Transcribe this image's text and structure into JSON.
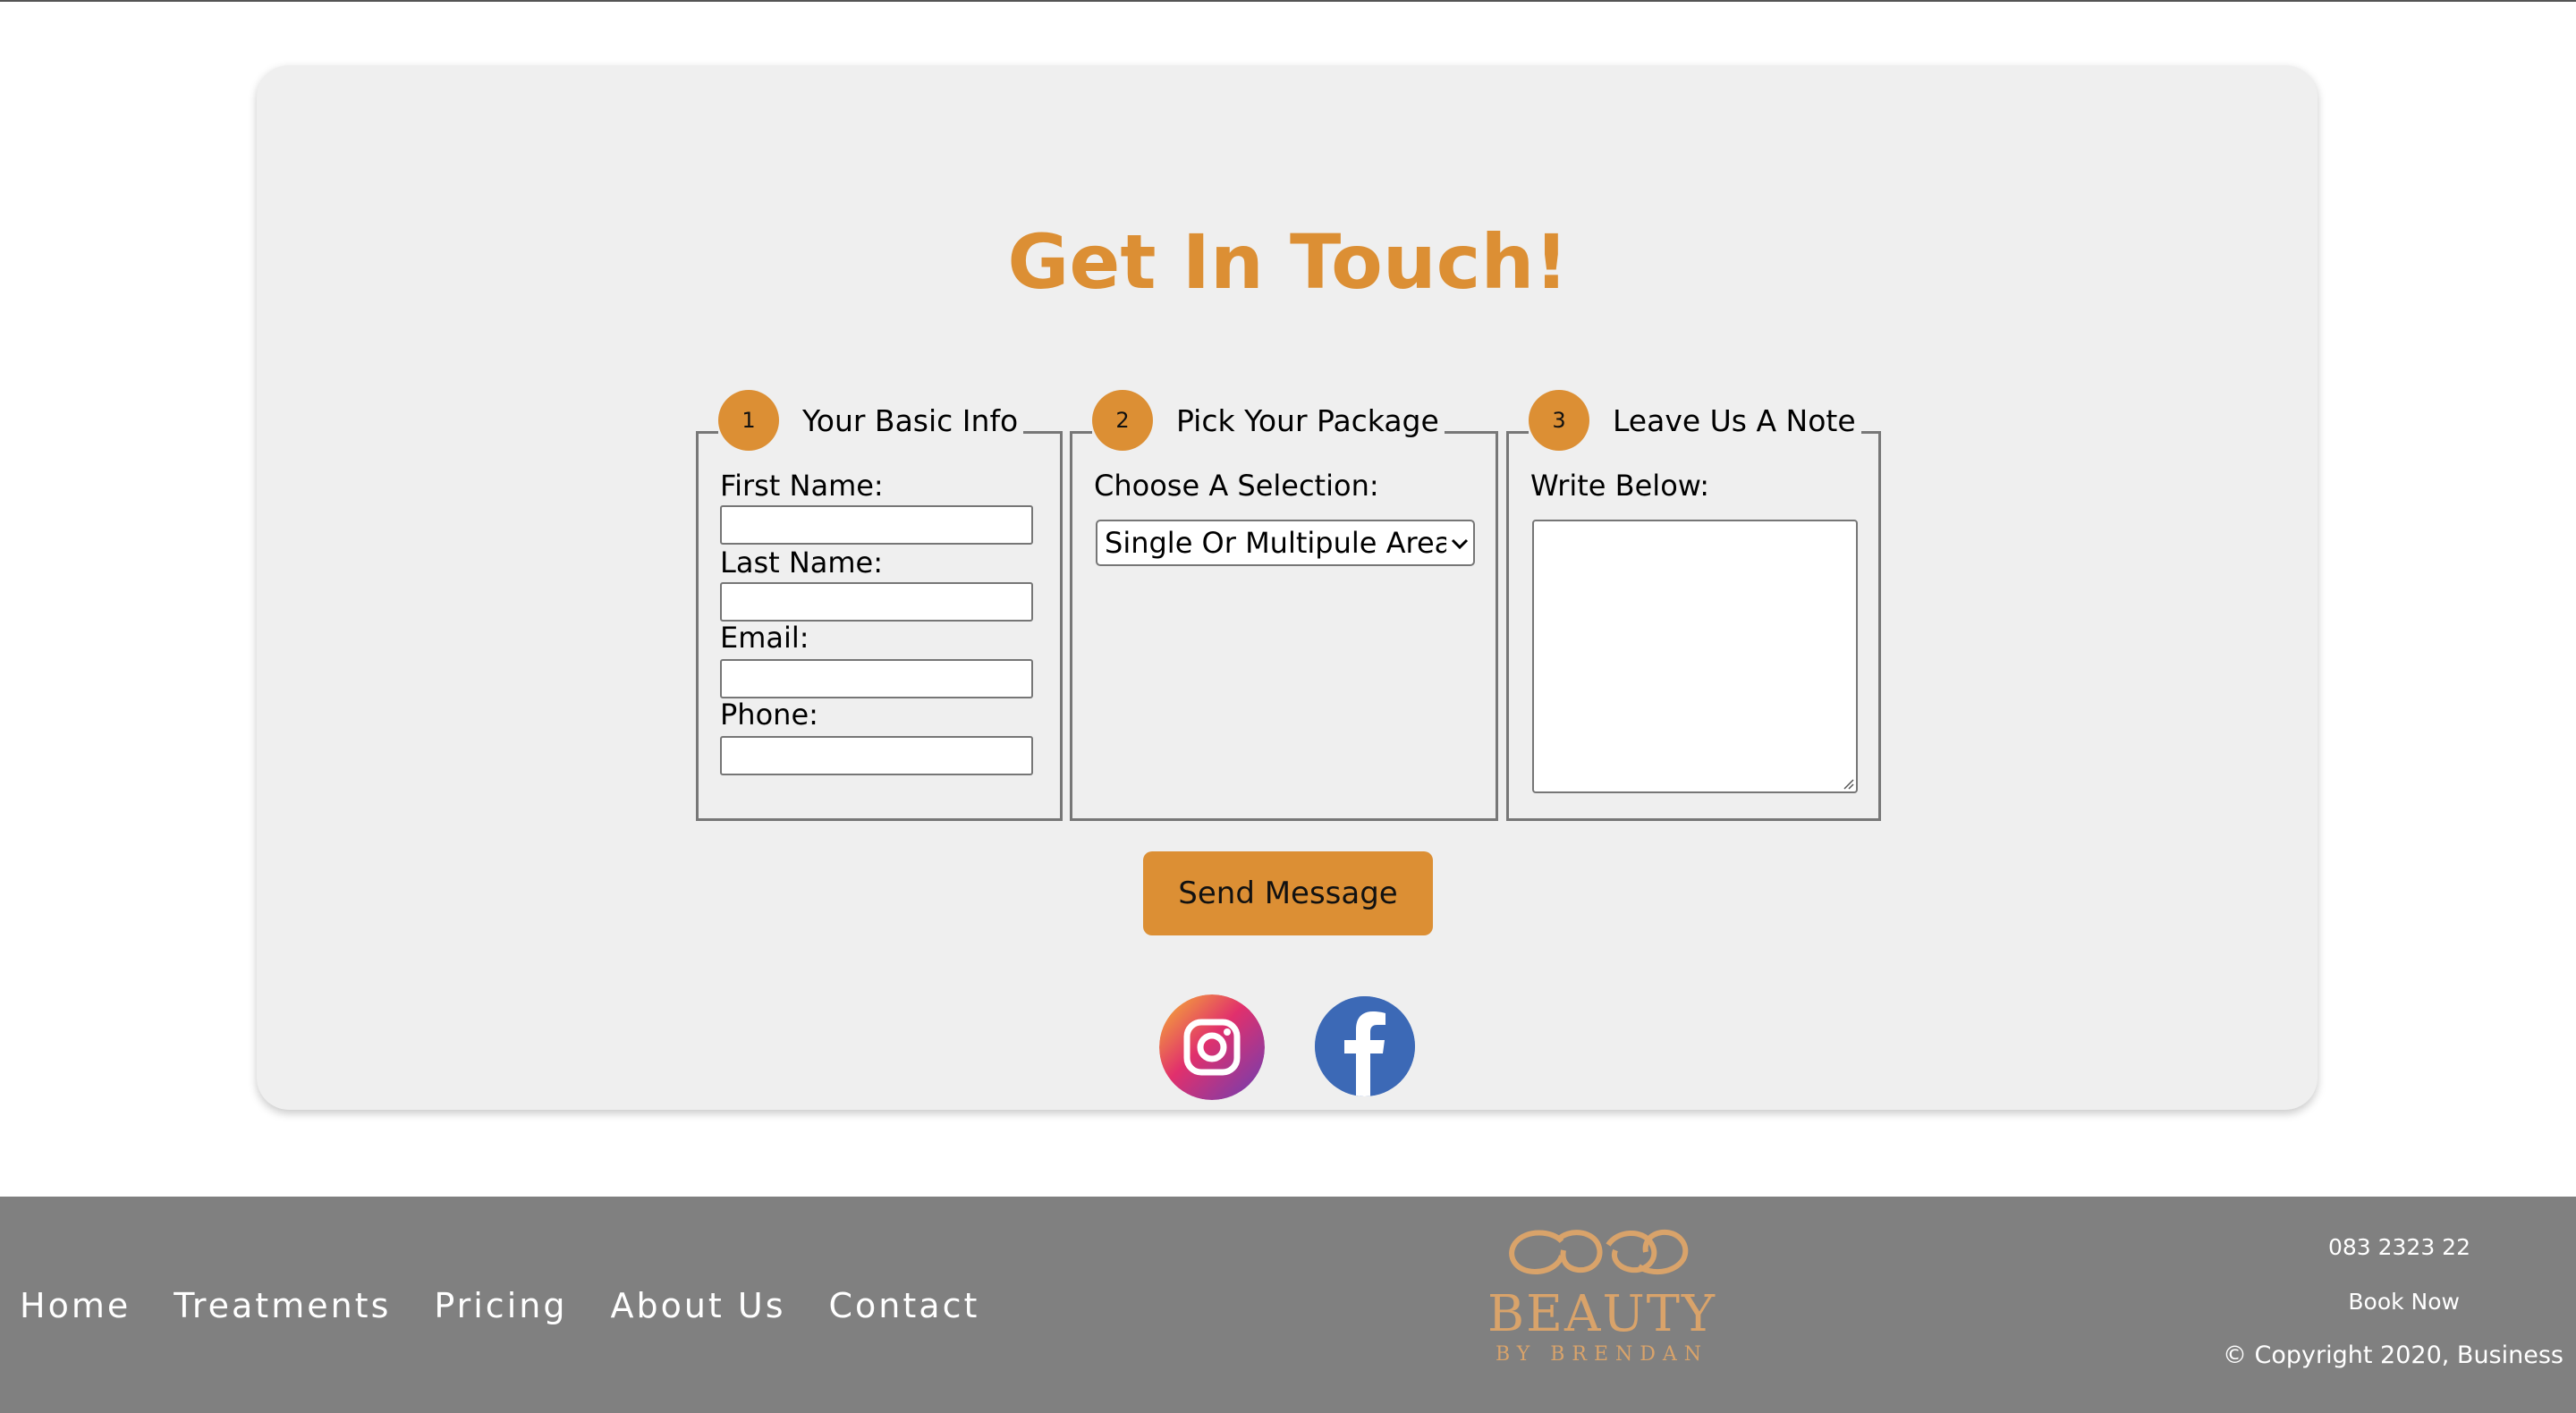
{
  "contact": {
    "heading": "Get In Touch!",
    "steps": [
      {
        "number": "1",
        "title": "Your Basic Info"
      },
      {
        "number": "2",
        "title": "Pick Your Package"
      },
      {
        "number": "3",
        "title": "Leave Us A Note"
      }
    ],
    "fields": {
      "first_name": "First Name:",
      "last_name": "Last Name:",
      "email": "Email:",
      "phone": "Phone:"
    },
    "package": {
      "label": "Choose A Selection:",
      "selected": "Single Or Multipule Area"
    },
    "note": {
      "label": "Write Below:"
    },
    "send_label": "Send Message",
    "accent_color": "#dc8f34"
  },
  "social": [
    {
      "name": "instagram-icon"
    },
    {
      "name": "facebook-icon"
    }
  ],
  "footer": {
    "nav": [
      "Home",
      "Treatments",
      "Pricing",
      "About Us",
      "Contact"
    ],
    "logo": {
      "title": "BEAUTY",
      "subtitle": "BY BRENDAN"
    },
    "phone": "083 2323 22",
    "book_now": "Book Now",
    "copyright": "© Copyright 2020, Business",
    "background": "#808080"
  }
}
